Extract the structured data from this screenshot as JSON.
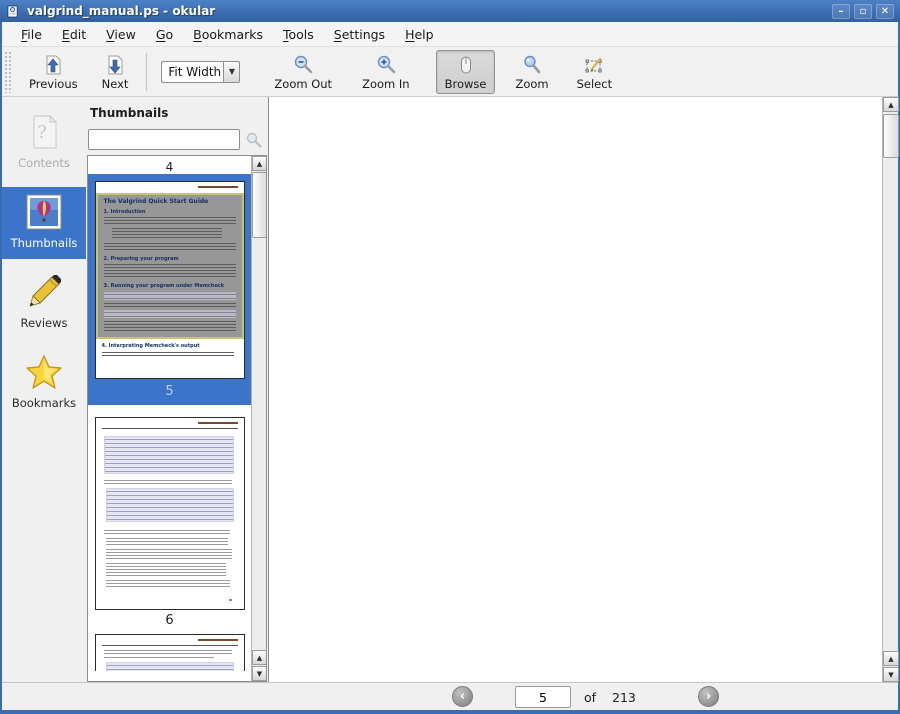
{
  "window": {
    "title": "valgrind_manual.ps - okular",
    "controls": {
      "minimize": "–",
      "maximize": "▫",
      "close": "✕"
    }
  },
  "menu": {
    "items": [
      {
        "label": "File"
      },
      {
        "label": "Edit"
      },
      {
        "label": "View"
      },
      {
        "label": "Go"
      },
      {
        "label": "Bookmarks"
      },
      {
        "label": "Tools"
      },
      {
        "label": "Settings"
      },
      {
        "label": "Help"
      }
    ]
  },
  "toolbar": {
    "previous": "Previous",
    "next": "Next",
    "zoom_mode": "Fit Width",
    "zoom_out": "Zoom Out",
    "zoom_in": "Zoom In",
    "browse": "Browse",
    "zoom": "Zoom",
    "select": "Select",
    "drop_arrow": "▼"
  },
  "sidebar": {
    "items": [
      {
        "label": "Contents",
        "state": "disabled"
      },
      {
        "label": "Thumbnails",
        "state": "selected"
      },
      {
        "label": "Reviews",
        "state": "normal"
      },
      {
        "label": "Bookmarks",
        "state": "normal"
      }
    ]
  },
  "thumbs": {
    "title": "Thumbnails",
    "search_value": "",
    "page_above_label": "4",
    "selected_page": {
      "label": "5",
      "headings": {
        "title": "The Valgrind Quick Start Guide",
        "s1": "1. Introduction",
        "s2": "2. Preparing your program",
        "s3": "3. Running your program under Memcheck",
        "s4": "4. Interpreting Memcheck's output"
      }
    },
    "next_page_label": "6"
  },
  "pager": {
    "current": "5",
    "of": "of",
    "total": "213"
  },
  "icons": {
    "up_arrow": "▲",
    "down_arrow": "▼",
    "back_chevron": "‹",
    "forward_chevron": "›"
  },
  "colors": {
    "titlebar": "#3d6fb4",
    "selection": "#3b74c8",
    "viewport_border": "#c6c66c"
  }
}
